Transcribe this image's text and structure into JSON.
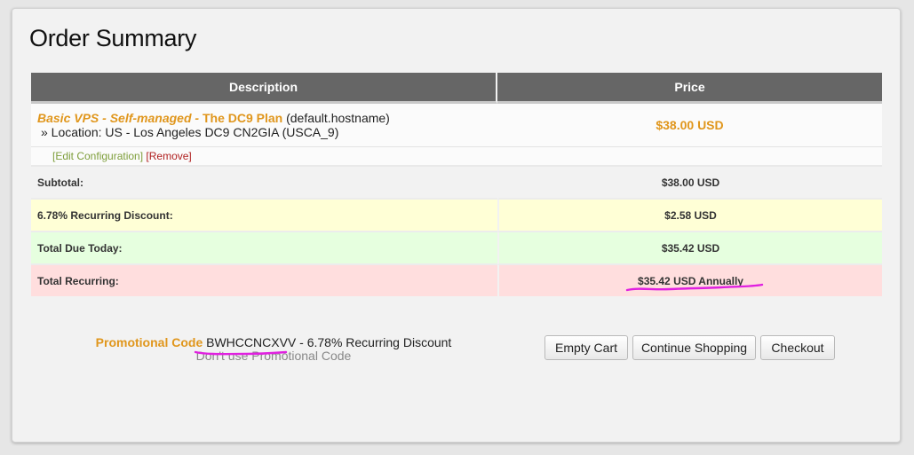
{
  "title": "Order Summary",
  "table": {
    "col_description": "Description",
    "col_price": "Price"
  },
  "product": {
    "name": "Basic VPS - Self-managed",
    "separator": " - ",
    "group": "The DC9 Plan",
    "hostname": "(default.hostname)",
    "location": "» Location: US - Los Angeles DC9 CN2GIA (USCA_9)",
    "price": "$38.00 USD",
    "edit_label": "[Edit Configuration]",
    "remove_label": "[Remove]"
  },
  "totals": {
    "subtotal_label": "Subtotal:",
    "subtotal_value": "$38.00 USD",
    "discount_label": "6.78% Recurring Discount:",
    "discount_value": "$2.58 USD",
    "due_today_label": "Total Due Today:",
    "due_today_value": "$35.42 USD",
    "recurring_label": "Total Recurring:",
    "recurring_value": "$35.42 USD Annually"
  },
  "promo": {
    "label": "Promotional Code",
    "code": "BWHCCNCXVV",
    "description": " - 6.78% Recurring Discount",
    "remove_label": "Don't use Promotional Code"
  },
  "buttons": {
    "empty_cart": "Empty Cart",
    "continue_shopping": "Continue Shopping",
    "checkout": "Checkout"
  },
  "colors": {
    "accent": "#e0961c",
    "header_bg": "#666666",
    "discount_bg": "#ffffd6",
    "due_today_bg": "#e6ffdf",
    "recurring_bg": "#ffdede",
    "annotation": "#e020e0"
  }
}
